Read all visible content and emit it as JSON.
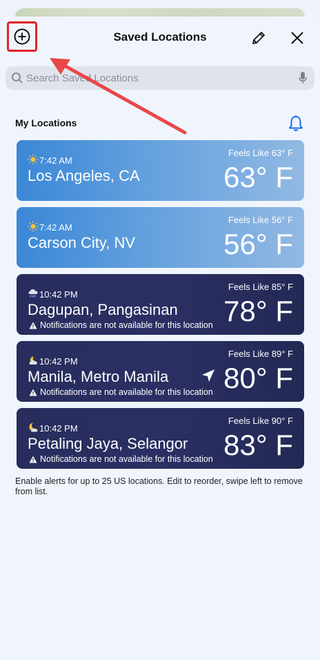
{
  "header": {
    "title": "Saved Locations",
    "add_icon": "plus-circle-icon",
    "edit_icon": "pencil-icon",
    "close_icon": "close-icon"
  },
  "search": {
    "placeholder": "Search Saved Locations",
    "search_icon": "search-icon",
    "mic_icon": "microphone-icon"
  },
  "section": {
    "title": "My Locations",
    "bell_icon": "bell-icon"
  },
  "colors": {
    "accent": "#1a6fe0",
    "highlight_box": "#e5202a",
    "day_card": "#3a87d6",
    "night_card": "#282d5e"
  },
  "locations": [
    {
      "time": "7:42 AM",
      "city": "Los Angeles, CA",
      "feels_like": "Feels Like 63° F",
      "temp": "63° F",
      "icon": "sun-icon",
      "theme": "day",
      "notice": ""
    },
    {
      "time": "7:42 AM",
      "city": "Carson City, NV",
      "feels_like": "Feels Like 56° F",
      "temp": "56° F",
      "icon": "sun-icon",
      "theme": "day",
      "notice": ""
    },
    {
      "time": "10:42 PM",
      "city": "Dagupan, Pangasinan",
      "feels_like": "Feels Like 85° F",
      "temp": "78° F",
      "icon": "rain-cloud-icon",
      "theme": "night",
      "notice": "Notifications are not available for this location"
    },
    {
      "time": "10:42 PM",
      "city": "Manila, Metro Manila",
      "feels_like": "Feels Like 89° F",
      "temp": "80° F",
      "icon": "partly-cloudy-night-icon",
      "theme": "night",
      "notice": "Notifications are not available for this location",
      "current_location_icon": "location-arrow-icon"
    },
    {
      "time": "10:42 PM",
      "city": "Petaling Jaya, Selangor",
      "feels_like": "Feels Like 90° F",
      "temp": "83° F",
      "icon": "moon-cloud-icon",
      "theme": "night",
      "notice": "Notifications are not available for this location"
    }
  ],
  "footnote": "Enable alerts for up to 25 US locations. Edit to reorder, swipe left to remove from list."
}
